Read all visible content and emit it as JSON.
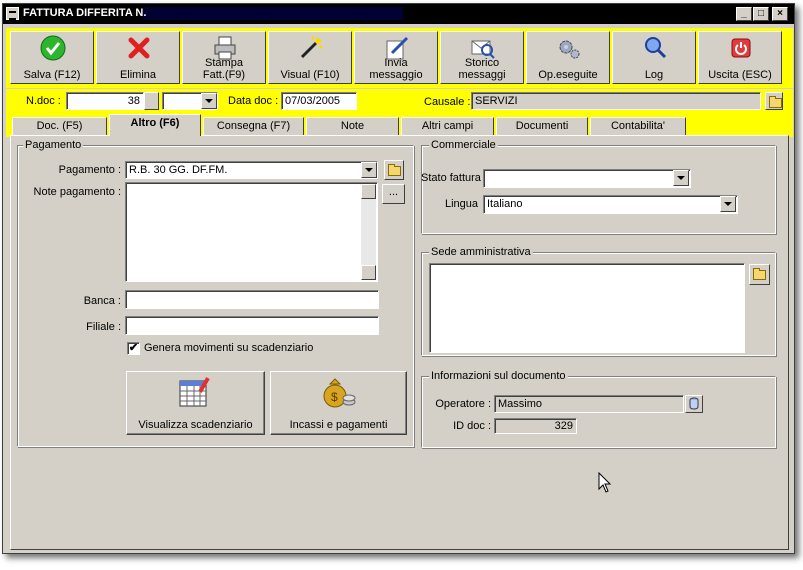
{
  "window": {
    "title": "FATTURA DIFFERITA N.",
    "min": "_",
    "max": "□",
    "close": "×"
  },
  "toolbar": [
    {
      "id": "save",
      "label": "Salva (F12)",
      "icon": "check-icon"
    },
    {
      "id": "delete",
      "label": "Elimina",
      "icon": "x-icon"
    },
    {
      "id": "print",
      "label": "Stampa\nFatt.(F9)",
      "icon": "printer-icon"
    },
    {
      "id": "visual",
      "label": "Visual (F10)",
      "icon": "magic-wand-icon"
    },
    {
      "id": "send",
      "label": "Invia\nmessaggio",
      "icon": "pen-paper-icon"
    },
    {
      "id": "history",
      "label": "Storico\nmessaggi",
      "icon": "envelope-search-icon"
    },
    {
      "id": "ops",
      "label": "Op.eseguite",
      "icon": "gears-icon"
    },
    {
      "id": "log",
      "label": "Log",
      "icon": "magnifier-icon"
    },
    {
      "id": "exit",
      "label": "Uscita (ESC)",
      "icon": "power-icon"
    }
  ],
  "header": {
    "ndoc_label": "N.doc :",
    "ndoc_value": "38",
    "series_value": "",
    "date_label": "Data doc :",
    "date_value": "07/03/2005",
    "causale_label": "Causale :",
    "causale_value": "SERVIZI"
  },
  "tabs": [
    "Doc. (F5)",
    "Altro (F6)",
    "Consegna (F7)",
    "Note",
    "Altri campi",
    "Documenti",
    "Contabilita'"
  ],
  "active_tab": "Altro (F6)",
  "pagamento": {
    "group_title": "Pagamento",
    "pagamento_label": "Pagamento :",
    "pagamento_value": "R.B. 30 GG. DF.FM.",
    "note_label": "Note pagamento :",
    "note_value": "",
    "more_label": "...",
    "banca_label": "Banca :",
    "banca_value": "",
    "filiale_label": "Filiale :",
    "filiale_value": "",
    "checkbox_label": "Genera movimenti su scadenziario",
    "checkbox_checked": true,
    "check_mark": "✔",
    "btn_scadenziario": "Visualizza scadenziario",
    "btn_incassi": "Incassi e pagamenti"
  },
  "commerciale": {
    "group_title": "Commerciale",
    "stato_label": "Stato fattura",
    "stato_value": "",
    "lingua_label": "Lingua",
    "lingua_value": "Italiano"
  },
  "sede": {
    "group_title": "Sede amministrativa",
    "value": ""
  },
  "info": {
    "group_title": "Informazioni sul documento",
    "operatore_label": "Operatore :",
    "operatore_value": "Massimo",
    "id_label": "ID doc :",
    "id_value": "329"
  },
  "colors": {
    "toolbar_bg": "#ffff00",
    "window_bg": "#d4d0c8"
  }
}
